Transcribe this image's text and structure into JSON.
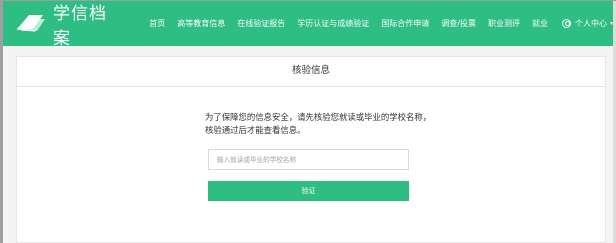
{
  "brand": {
    "name": "学信档案",
    "logo_icon": "book-stack-icon"
  },
  "nav": {
    "items": [
      "首页",
      "高等教育信息",
      "在线验证报告",
      "学历认证与成绩验证",
      "国际合作申请",
      "调查/投票",
      "职业测评",
      "就业"
    ],
    "user_label": "个人中心",
    "user_caret": "▾"
  },
  "page": {
    "title": "核验信息",
    "description": "为了保障您的信息安全，请先核验您就读或毕业的学校名称，核验通过后才能查看信息。",
    "input_placeholder": "输入就读或毕业的学校名称",
    "input_value": "",
    "button_label": "验证"
  },
  "colors": {
    "brand_green": "#2ebd82",
    "background": "#f4f4f4"
  }
}
